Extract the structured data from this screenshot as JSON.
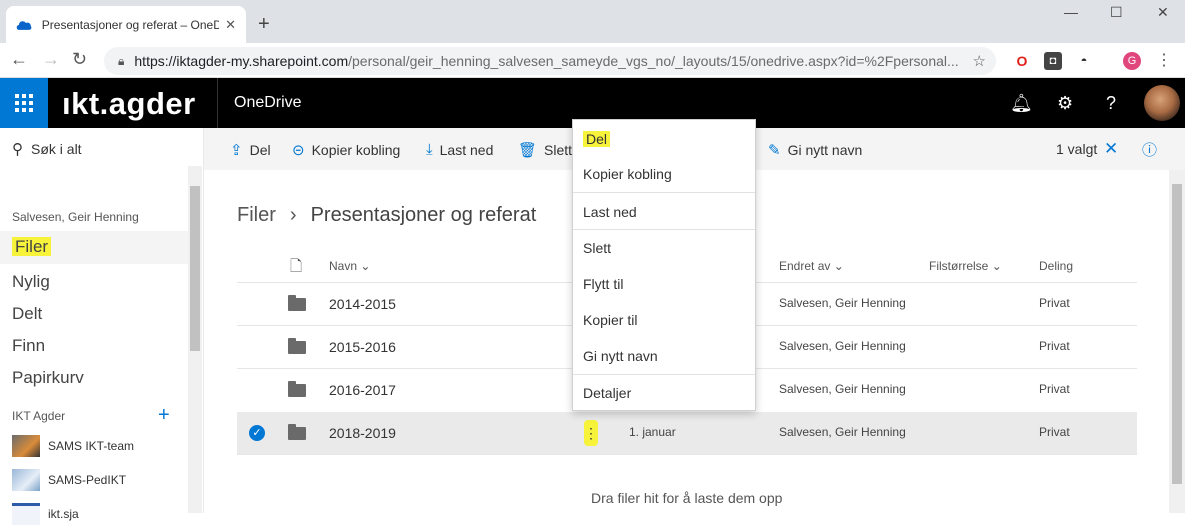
{
  "browser": {
    "tab_title": "Presentasjoner og referat – OneD",
    "url_host": "https://iktagder-my.sharepoint.com",
    "url_path": "/personal/geir_henning_salvesen_sameyde_vgs_no/_layouts/15/onedrive.aspx?id=%2Fpersonal...",
    "profile_initial": "G"
  },
  "suite": {
    "brand": "ıkt.agder",
    "app_name": "OneDrive"
  },
  "nav": {
    "search_placeholder": "Søk i alt",
    "user_name": "Salvesen, Geir Henning",
    "items": [
      "Filer",
      "Nylig",
      "Delt",
      "Finn",
      "Papirkurv"
    ],
    "group_label": "IKT Agder",
    "sites": [
      "SAMS IKT-team",
      "SAMS-PedIKT",
      "ikt.sja"
    ]
  },
  "commands": {
    "share": "Del",
    "copy_link": "Kopier kobling",
    "download": "Last ned",
    "delete": "Slett",
    "rename": "Gi nytt navn",
    "selected_count": "1 valgt"
  },
  "breadcrumb": {
    "root": "Filer",
    "current": "Presentasjoner og referat"
  },
  "columns": {
    "name": "Navn",
    "modified_by": "Endret av",
    "size": "Filstørrelse",
    "sharing": "Deling"
  },
  "rows": [
    {
      "name": "2014-2015",
      "modified": "",
      "modified_by": "Salvesen, Geir Henning",
      "sharing": "Privat"
    },
    {
      "name": "2015-2016",
      "modified": "",
      "modified_by": "Salvesen, Geir Henning",
      "sharing": "Privat"
    },
    {
      "name": "2016-2017",
      "modified": "",
      "modified_by": "Salvesen, Geir Henning",
      "sharing": "Privat"
    },
    {
      "name": "2018-2019",
      "modified": "1. januar",
      "modified_by": "Salvesen, Geir Henning",
      "sharing": "Privat"
    }
  ],
  "drop_hint": "Dra filer hit for å laste dem opp",
  "context_menu": [
    "Del",
    "Kopier kobling",
    "Last ned",
    "Slett",
    "Flytt til",
    "Kopier til",
    "Gi nytt navn",
    "Detaljer"
  ],
  "colors": {
    "accent": "#0078d4",
    "highlight": "#f7f23a",
    "suite_bg": "#000000"
  }
}
